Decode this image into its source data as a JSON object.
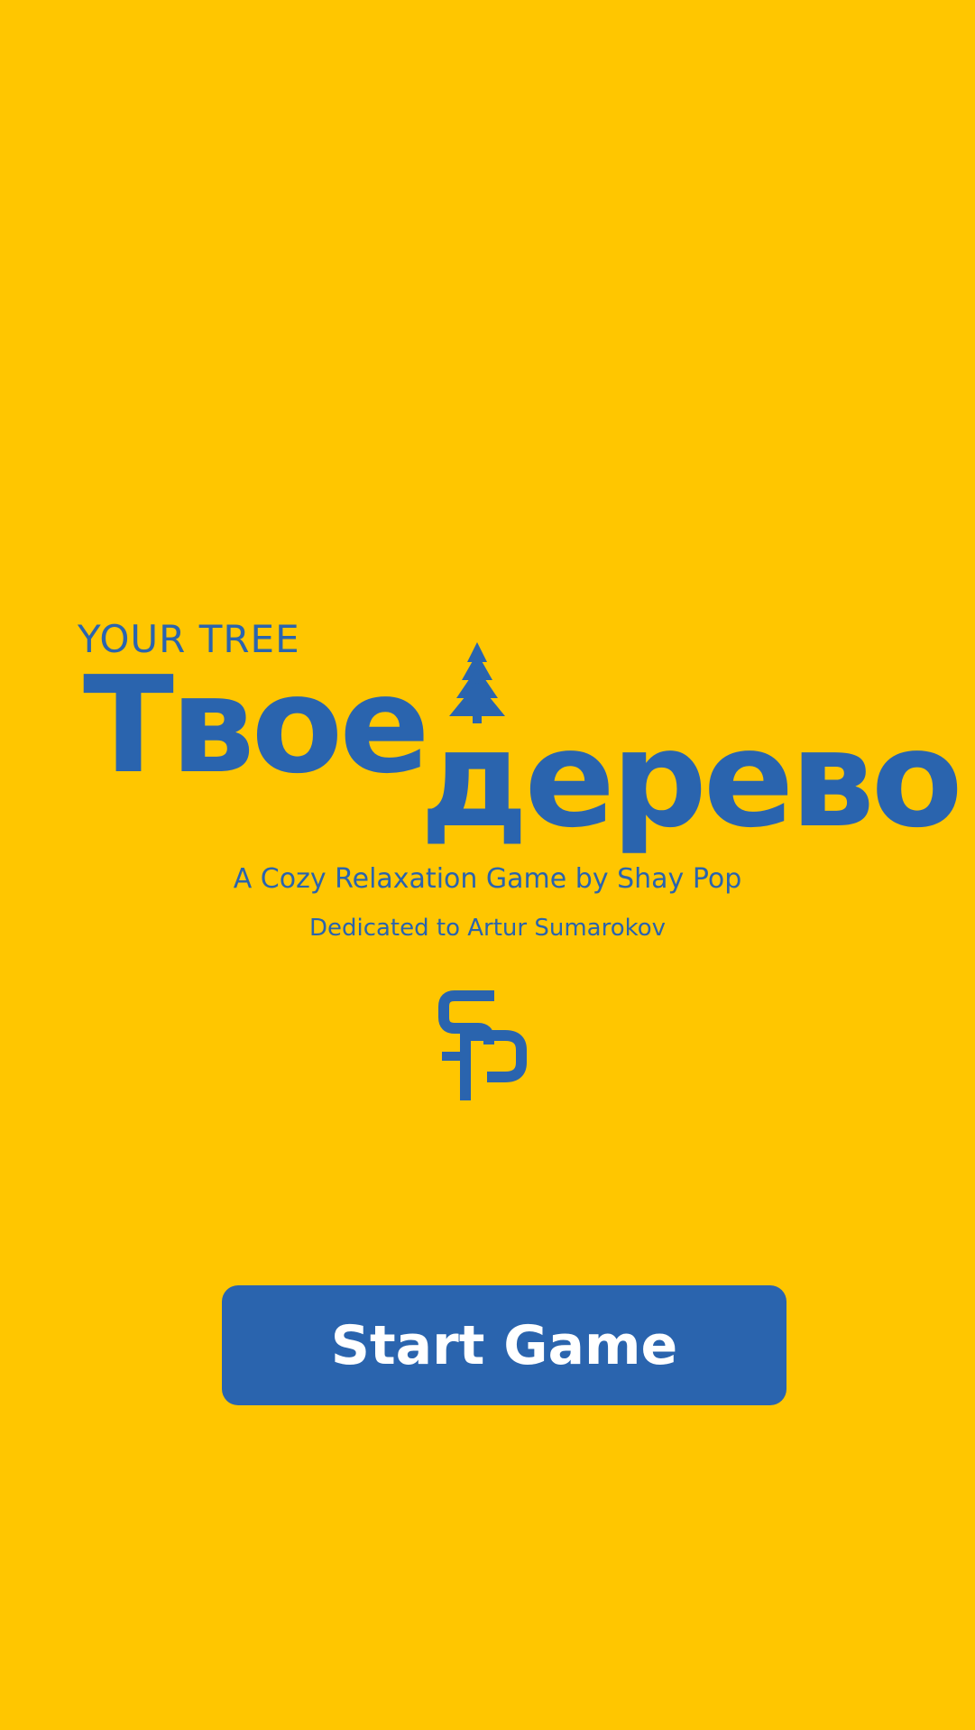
{
  "colors": {
    "background": "#FFC600",
    "primary": "#2A64AE",
    "button_text": "#FFFFFF"
  },
  "title": {
    "english": "YOUR TREE",
    "word1": "Твое",
    "word2": "дерево"
  },
  "icons": {
    "title_tree": "tree-icon",
    "studio_logo": "sp-logo"
  },
  "tagline": "A Cozy Relaxation Game by Shay Pop",
  "dedication": "Dedicated to Artur Sumarokov",
  "start_button": {
    "label": "Start Game"
  }
}
